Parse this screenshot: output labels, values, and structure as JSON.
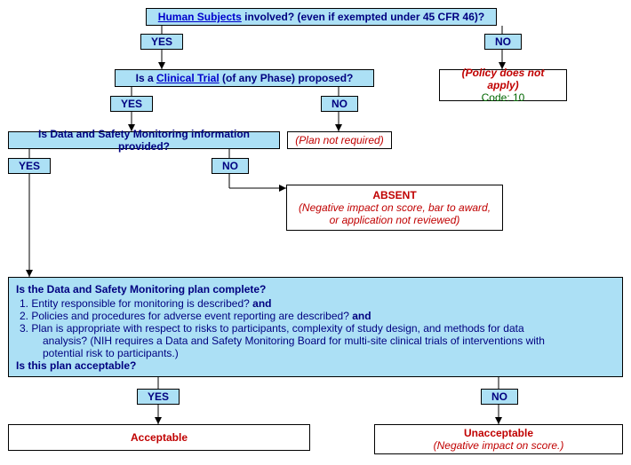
{
  "q1": {
    "link": "Human Subjects",
    "rest": " involved? (even if exempted under 45 CFR 46)?",
    "yes": "YES",
    "no": "NO",
    "no_result_line1": "(Policy does not apply)",
    "no_result_line2": "Code: 10"
  },
  "q2": {
    "prefix": "Is a ",
    "link": "Clinical Trial",
    "rest": " (of any Phase) proposed?",
    "yes": "YES",
    "no": "NO",
    "no_result": "(Plan not required)"
  },
  "q3": {
    "text": "Is Data and Safety Monitoring information provided?",
    "yes": "YES",
    "no": "NO",
    "absent_title": "ABSENT",
    "absent_line1": "(Negative impact on score, bar to award,",
    "absent_line2": "or application not reviewed)"
  },
  "q4": {
    "title": "Is the Data and Safety Monitoring plan complete?",
    "item1": "1. Entity responsible for monitoring is described? ",
    "and1": "and",
    "item2": "2. Policies and procedures for adverse event reporting are described? ",
    "and2": "and",
    "item3a": "3. Plan is appropriate with respect to risks to participants, complexity of study design, and methods for data",
    "item3b": "analysis? (NIH requires a Data and Safety Monitoring Board for multi-site clinical trials of interventions with",
    "item3c": "potential risk to participants.)",
    "footer": "Is this plan acceptable?",
    "yes": "YES",
    "no": "NO",
    "acceptable": "Acceptable",
    "unacceptable": "Unacceptable",
    "unacceptable_sub": "(Negative impact on score.)"
  }
}
